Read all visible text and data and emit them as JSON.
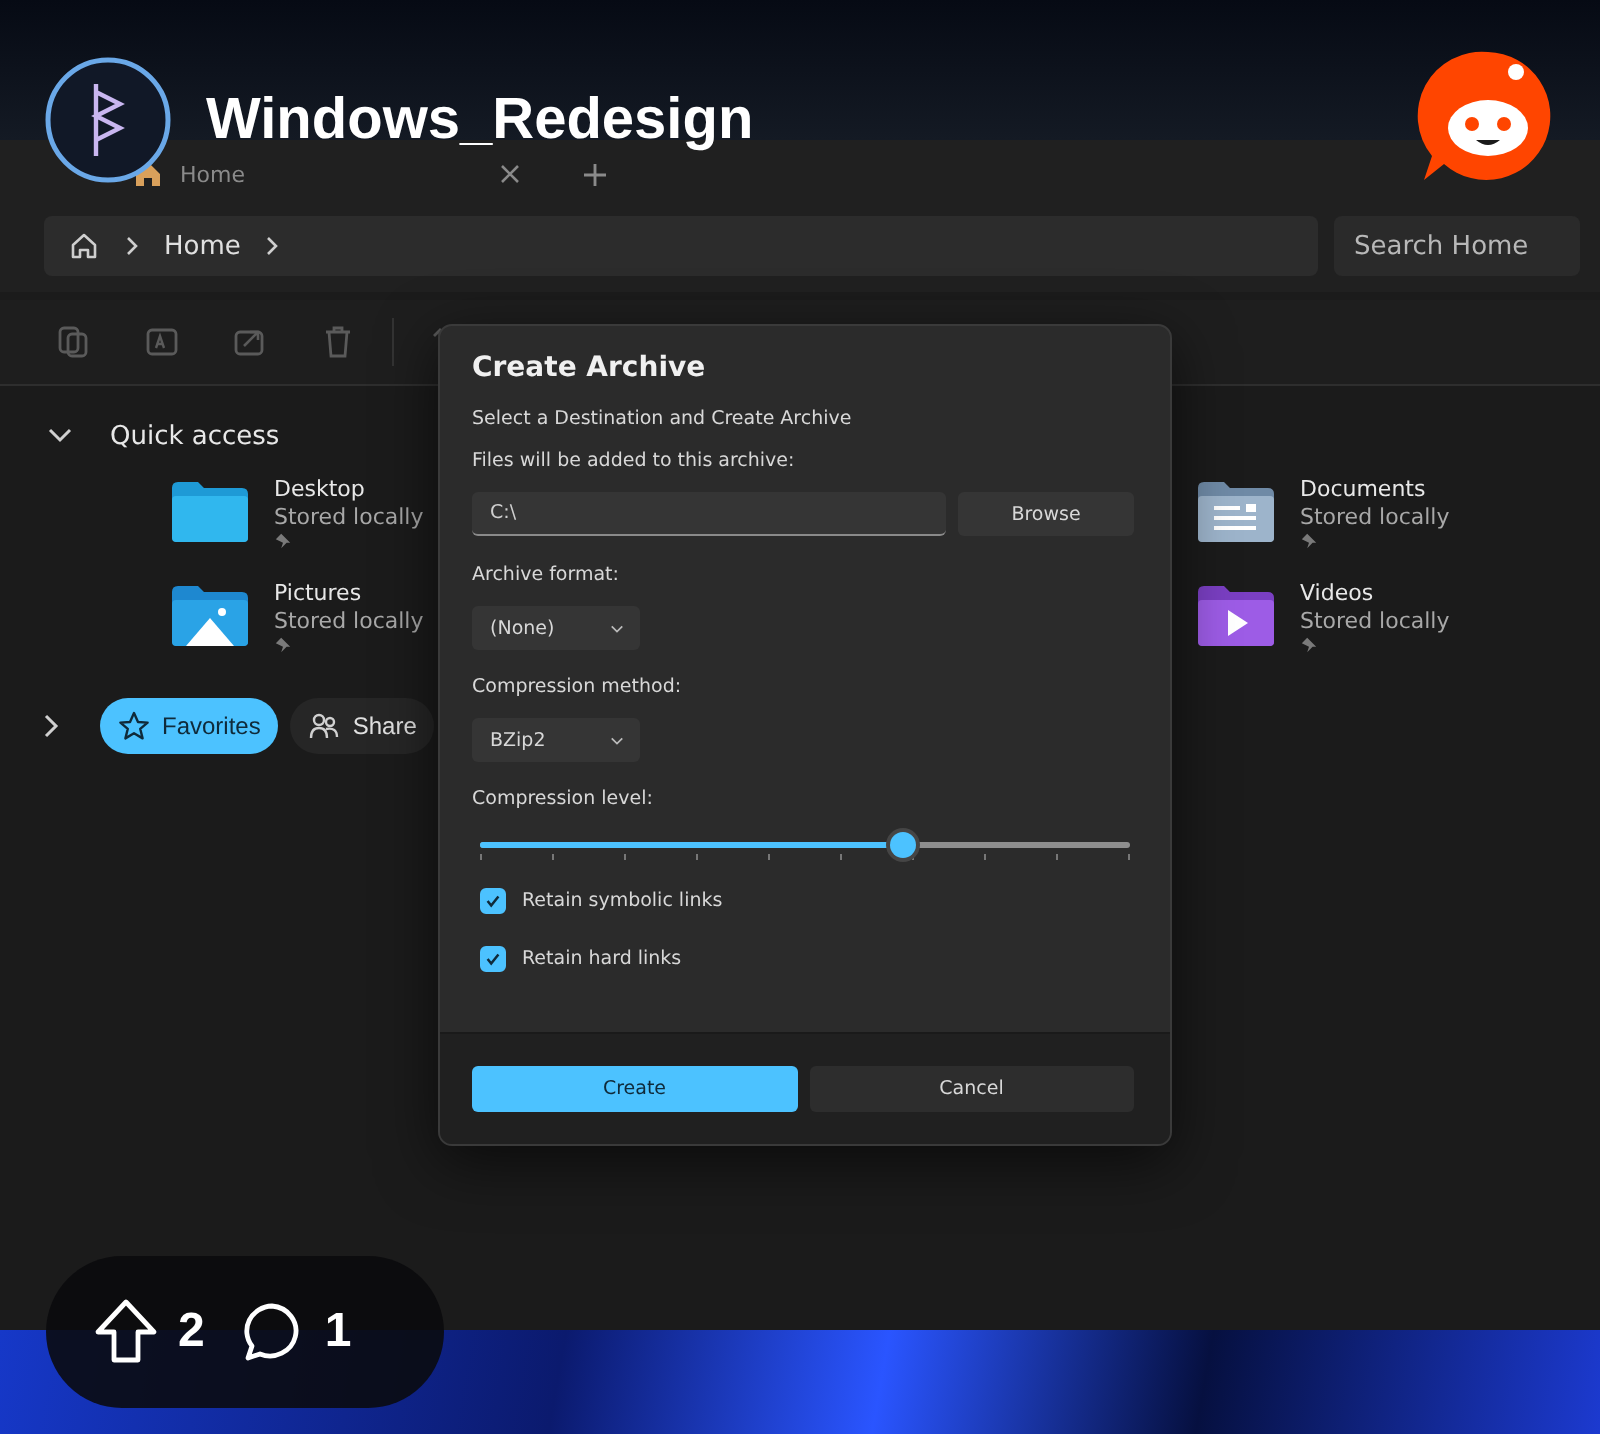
{
  "post": {
    "subreddit": "Windows_Redesign",
    "upvotes": "2",
    "comments": "1"
  },
  "explorer": {
    "tab": {
      "title": "Home"
    },
    "breadcrumb": [
      "Home"
    ],
    "search": {
      "placeholder": "Search Home"
    },
    "section": {
      "title": "Quick access",
      "expanded": true
    },
    "folders": [
      {
        "name": "Desktop",
        "status": "Stored locally",
        "kind": "desktop"
      },
      {
        "name": "Documents",
        "status": "Stored locally",
        "kind": "documents"
      },
      {
        "name": "Pictures",
        "status": "Stored locally",
        "kind": "pictures"
      },
      {
        "name": "Videos",
        "status": "Stored locally",
        "kind": "videos"
      }
    ],
    "groups_expanded": false,
    "groups": [
      {
        "label": "Favorites",
        "selected": true,
        "kind": "favorites"
      },
      {
        "label": "Share",
        "selected": false,
        "kind": "shared"
      }
    ]
  },
  "dialog": {
    "title": "Create Archive",
    "subtitle": "Select a Destination and Create Archive",
    "path_label": "Files will be added to this archive:",
    "path": "C:\\",
    "browse": "Browse",
    "format_label": "Archive format:",
    "format": "(None)",
    "method_label": "Compression method:",
    "method": "BZip2",
    "level_label": "Compression level:",
    "level": 0.65,
    "options": [
      {
        "label": "Retain symbolic links",
        "checked": true
      },
      {
        "label": "Retain hard links",
        "checked": true
      }
    ],
    "create": "Create",
    "cancel": "Cancel"
  }
}
